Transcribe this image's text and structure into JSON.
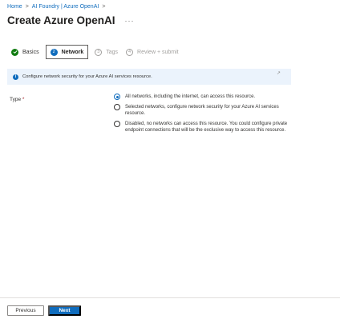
{
  "breadcrumb": {
    "items": [
      "Home",
      "AI Foundry | Azure OpenAI"
    ],
    "separator": ">"
  },
  "page": {
    "title": "Create Azure OpenAI",
    "more": "···"
  },
  "steps": [
    {
      "number": "✓",
      "label": "Basics",
      "state": "done"
    },
    {
      "number": "2",
      "label": "Network",
      "state": "active"
    },
    {
      "number": "3",
      "label": "Tags",
      "state": "future"
    },
    {
      "number": "4",
      "label": "Review + submit",
      "state": "future"
    }
  ],
  "info": {
    "icon": "i",
    "text": "Configure network security for your Azure AI services resource.",
    "dismiss": "↗"
  },
  "type_field": {
    "label": "Type",
    "required_mark": "*",
    "selected": 0,
    "options": [
      "All networks, including the internet, can access this resource.",
      "Selected networks, configure network security for your Azure AI services resource.",
      "Disabled, no networks can access this resource. You could configure private endpoint connections that will be the exclusive way to access this resource."
    ]
  },
  "footer": {
    "previous_label": "Previous",
    "next_label": "Next"
  },
  "colors": {
    "accent": "#0f6cbd",
    "success": "#107c10",
    "info_bg": "#ebf3fc",
    "required": "#a4262c"
  }
}
